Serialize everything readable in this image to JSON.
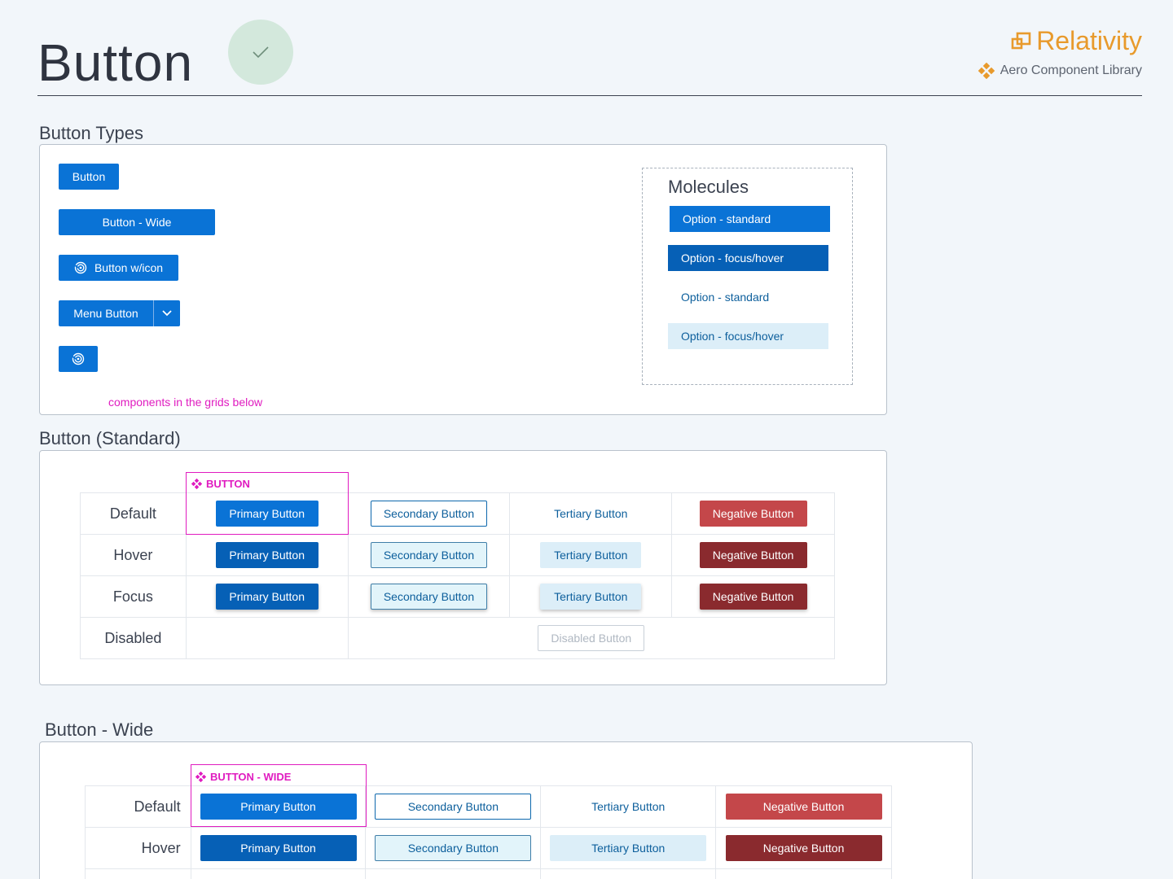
{
  "header": {
    "title": "Button",
    "brand_name": "Relativity",
    "brand_sub": "Aero Component Library"
  },
  "colors": {
    "primary": "#0a73d6",
    "primary_hover": "#0660b6",
    "negative": "#c4474a",
    "negative_hover": "#8a2a2e",
    "brand": "#e89a2c",
    "annotation": "#e01cc0"
  },
  "button_types": {
    "title": "Button Types",
    "button": "Button",
    "button_wide": "Button - Wide",
    "button_icon": "Button w/icon",
    "menu_button": "Menu Button",
    "note": "components in the grids below",
    "molecules": {
      "title": "Molecules",
      "options": [
        "Option - standard",
        "Option - focus/hover",
        "Option - standard",
        "Option - focus/hover"
      ]
    }
  },
  "standard": {
    "title": "Button (Standard)",
    "tag": "BUTTON",
    "rows": [
      "Default",
      "Hover",
      "Focus",
      "Disabled"
    ],
    "primary": "Primary Button",
    "secondary": "Secondary Button",
    "tertiary": "Tertiary Button",
    "negative": "Negative Button",
    "disabled": "Disabled Button"
  },
  "wide": {
    "title": "Button - Wide",
    "tag": "BUTTON - WIDE",
    "rows": [
      "Default",
      "Hover"
    ],
    "primary": "Primary Button",
    "secondary": "Secondary Button",
    "tertiary": "Tertiary Button",
    "negative": "Negative Button"
  }
}
